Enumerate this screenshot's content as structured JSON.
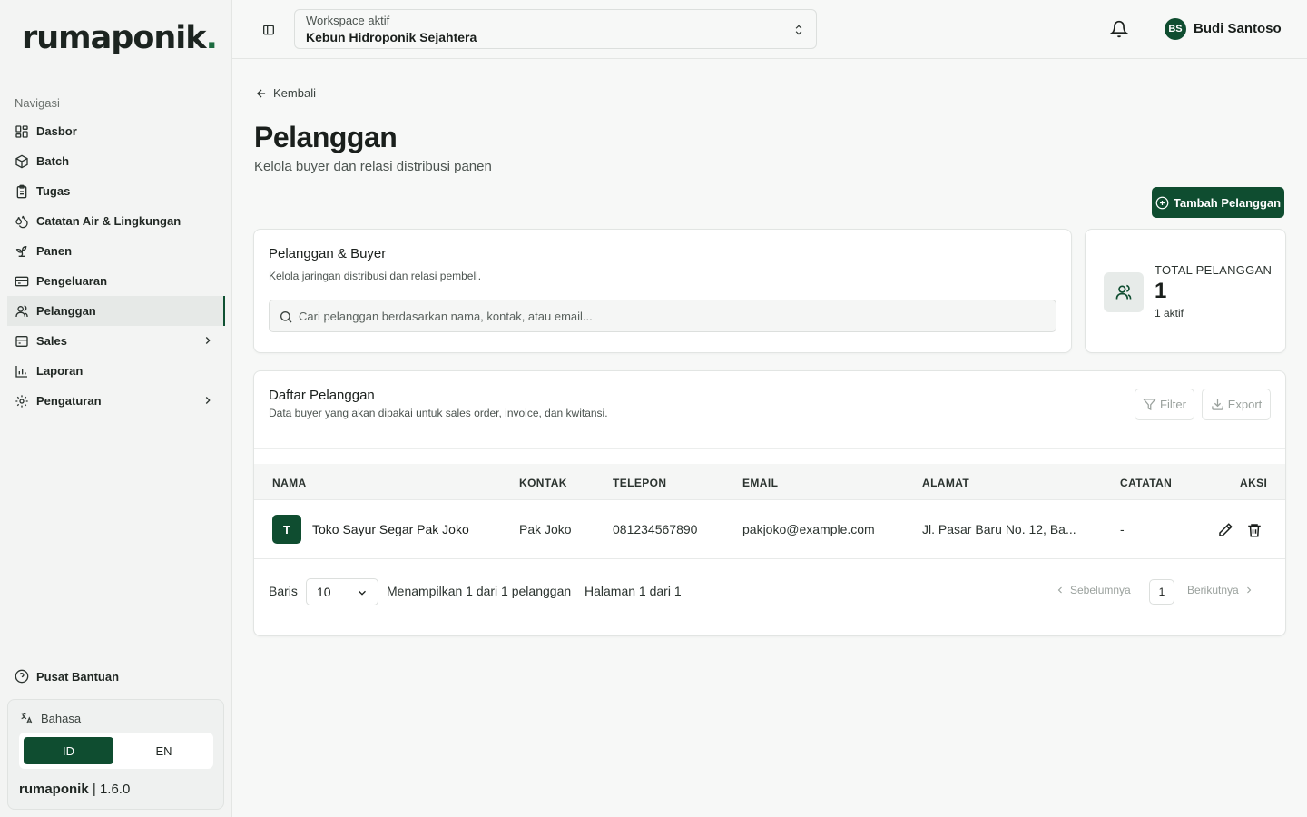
{
  "app": {
    "logo_text": "rumaponik",
    "logo_dot": "."
  },
  "sidebar": {
    "section_label": "Navigasi",
    "items": [
      {
        "label": "Dasbor",
        "icon": "dashboard-icon"
      },
      {
        "label": "Batch",
        "icon": "package-icon"
      },
      {
        "label": "Tugas",
        "icon": "clipboard-icon"
      },
      {
        "label": "Catatan Air & Lingkungan",
        "icon": "droplets-icon"
      },
      {
        "label": "Panen",
        "icon": "sprout-icon"
      },
      {
        "label": "Pengeluaran",
        "icon": "wallet-icon"
      },
      {
        "label": "Pelanggan",
        "icon": "users-icon",
        "active": true
      },
      {
        "label": "Sales",
        "icon": "receipt-icon",
        "has_submenu": true
      },
      {
        "label": "Laporan",
        "icon": "bar-chart-icon"
      },
      {
        "label": "Pengaturan",
        "icon": "gear-icon",
        "has_submenu": true
      }
    ],
    "help_label": "Pusat Bantuan",
    "language": {
      "title": "Bahasa",
      "options": [
        "ID",
        "EN"
      ],
      "selected": "ID"
    },
    "version": {
      "brand": "rumaponik",
      "separator": "|",
      "number": "1.6.0"
    }
  },
  "header": {
    "workspace_label": "Workspace aktif",
    "workspace_value": "Kebun Hidroponik Sejahtera",
    "user_initials": "BS",
    "user_name": "Budi Santoso"
  },
  "page": {
    "back_label": "Kembali",
    "title": "Pelanggan",
    "subtitle": "Kelola buyer dan relasi distribusi panen",
    "add_button": "Tambah Pelanggan"
  },
  "search_card": {
    "title": "Pelanggan & Buyer",
    "description": "Kelola jaringan distribusi dan relasi pembeli.",
    "placeholder": "Cari pelanggan berdasarkan nama, kontak, atau email..."
  },
  "stat_card": {
    "label": "TOTAL PELANGGAN",
    "value": "1",
    "sub": "1 aktif"
  },
  "list_card": {
    "title": "Daftar Pelanggan",
    "description": "Data buyer yang akan dipakai untuk sales order, invoice, dan kwitansi.",
    "filter_label": "Filter",
    "export_label": "Export",
    "columns": [
      "NAMA",
      "KONTAK",
      "TELEPON",
      "EMAIL",
      "ALAMAT",
      "CATATAN",
      "AKSI"
    ],
    "rows": [
      {
        "initial": "T",
        "name": "Toko Sayur Segar Pak Joko",
        "contact": "Pak Joko",
        "phone": "081234567890",
        "email": "pakjoko@example.com",
        "address": "Jl. Pasar Baru No. 12, Ba...",
        "notes": "-"
      }
    ],
    "pagination": {
      "rows_label": "Baris",
      "rows_per_page": "10",
      "info": "Menampilkan 1 dari 1 pelanggan",
      "page_info": "Halaman 1 dari 1",
      "prev_label": "Sebelumnya",
      "current_page": "1",
      "next_label": "Berikutnya"
    }
  },
  "colors": {
    "brand": "#0f4d30",
    "background": "#f7f8f7",
    "sidebar": "#f3f4f3"
  }
}
